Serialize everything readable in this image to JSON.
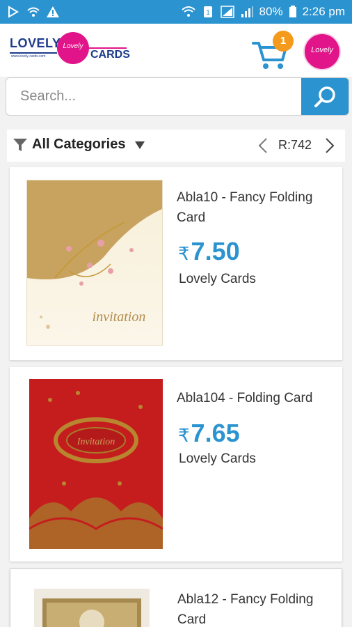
{
  "status_bar": {
    "battery": "80%",
    "time": "2:26 pm"
  },
  "header": {
    "logo_word1": "LOVELY",
    "logo_word2": "CARDS",
    "logo_url": "www.lovely-cards.com",
    "logo_script": "Lovely",
    "cart_count": "1",
    "avatar_text": "Lovely"
  },
  "search": {
    "placeholder": "Search..."
  },
  "filter": {
    "category": "All Categories",
    "range": "R:742"
  },
  "products": [
    {
      "name": "Abla10 - Fancy Folding Card",
      "currency": "₹",
      "price": "7.50",
      "seller": "Lovely Cards",
      "image_text": "invitation"
    },
    {
      "name": "Abla104 - Folding Card",
      "currency": "₹",
      "price": "7.65",
      "seller": "Lovely Cards",
      "image_text": "Invitation"
    },
    {
      "name": "Abla12 - Fancy Folding Card",
      "currency": "₹",
      "price": "",
      "seller": "",
      "image_text": ""
    }
  ],
  "colors": {
    "primary": "#2a93d0",
    "badge": "#f49a1c",
    "brand_pink": "#e1148a",
    "brand_navy": "#1d3b8c"
  }
}
